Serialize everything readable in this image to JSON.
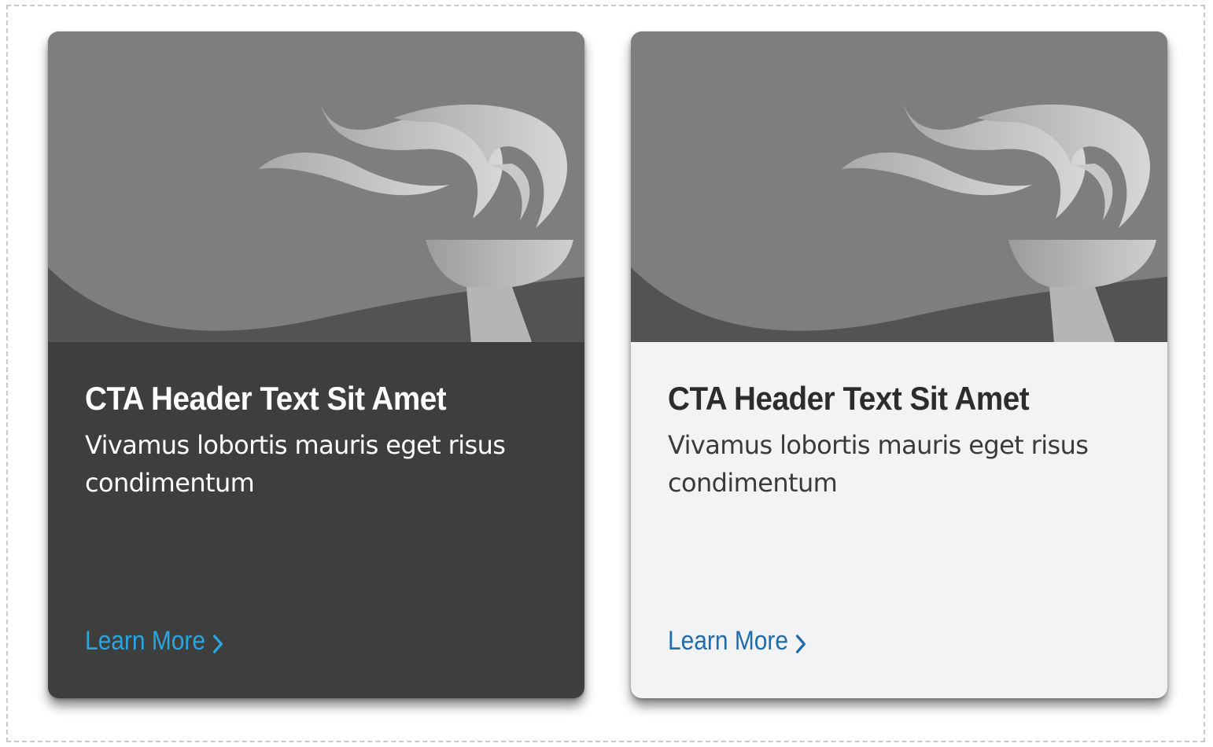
{
  "cards": [
    {
      "theme": "dark",
      "background_color": "#3e3e3e",
      "image_icon": "torch-flame-illustration",
      "title": "CTA Header Text Sit Amet",
      "description": "Vivamus lobortis mauris eget risus condimentum",
      "link_label": "Learn More",
      "link_icon": "chevron-right-icon",
      "link_color": "#2aa6df"
    },
    {
      "theme": "light",
      "background_color": "#f2f3f5",
      "image_icon": "torch-flame-illustration",
      "title": "CTA Header Text Sit Amet",
      "description": "Vivamus lobortis mauris eget risus condimentum",
      "link_label": "Learn More",
      "link_icon": "chevron-right-icon",
      "link_color": "#1f6bab"
    }
  ]
}
